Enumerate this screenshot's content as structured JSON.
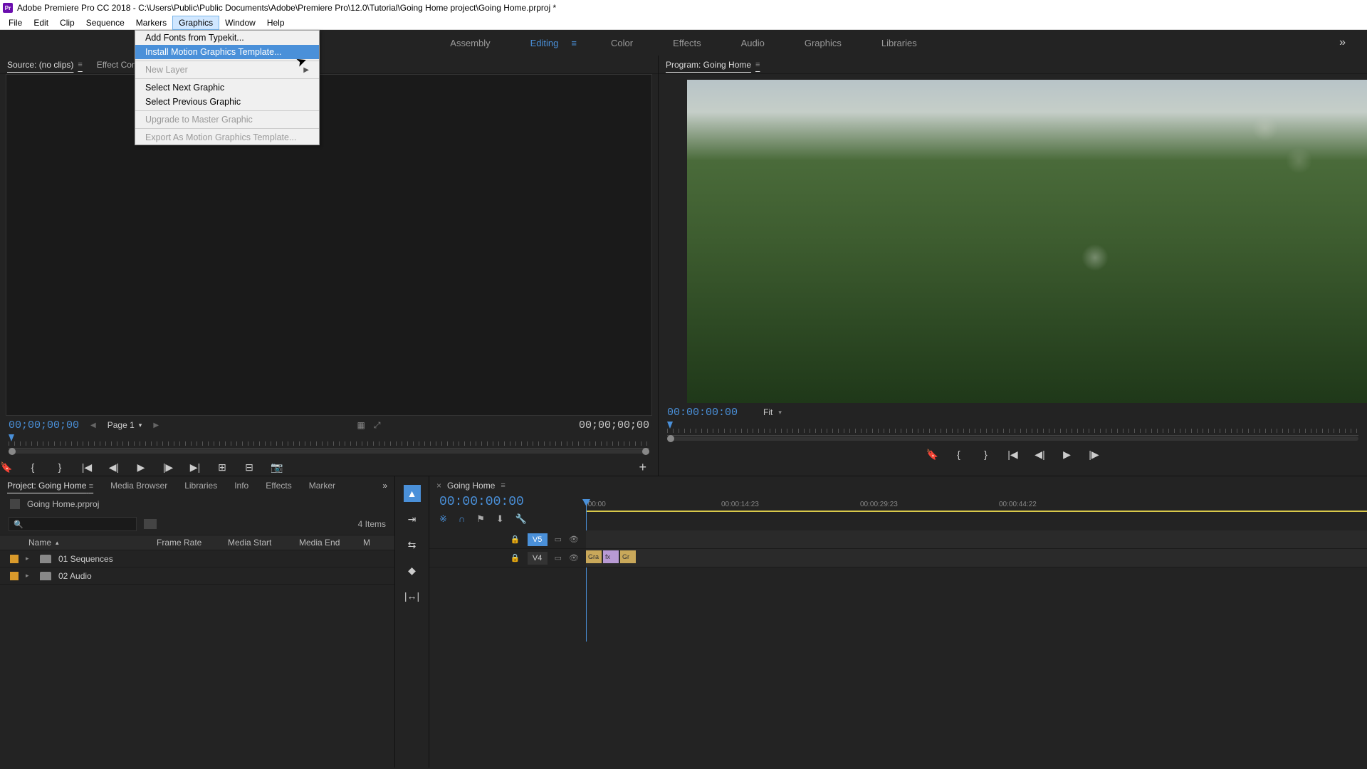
{
  "title": "Adobe Premiere Pro CC 2018 - C:\\Users\\Public\\Public Documents\\Adobe\\Premiere Pro\\12.0\\Tutorial\\Going Home project\\Going Home.prproj *",
  "app_icon": "Pr",
  "menubar": [
    "File",
    "Edit",
    "Clip",
    "Sequence",
    "Markers",
    "Graphics",
    "Window",
    "Help"
  ],
  "menubar_active": "Graphics",
  "workspaces": [
    "Assembly",
    "Editing",
    "Color",
    "Effects",
    "Audio",
    "Graphics",
    "Libraries"
  ],
  "workspace_active": "Editing",
  "dropdown": [
    {
      "label": "Add Fonts from Typekit...",
      "type": "item"
    },
    {
      "label": "Install Motion Graphics Template...",
      "type": "item",
      "highlighted": true
    },
    {
      "type": "sep"
    },
    {
      "label": "New Layer",
      "type": "item",
      "disabled": true,
      "submenu": true
    },
    {
      "type": "sep"
    },
    {
      "label": "Select Next Graphic",
      "type": "item"
    },
    {
      "label": "Select Previous Graphic",
      "type": "item"
    },
    {
      "type": "sep"
    },
    {
      "label": "Upgrade to Master Graphic",
      "type": "item",
      "disabled": true
    },
    {
      "type": "sep"
    },
    {
      "label": "Export As Motion Graphics Template...",
      "type": "item",
      "disabled": true
    }
  ],
  "source": {
    "tabs": [
      "Source: (no clips)",
      "Effect Cont"
    ],
    "timecode_left": "00;00;00;00",
    "page": "Page 1",
    "timecode_right": "00;00;00;00"
  },
  "program": {
    "title": "Program: Going Home",
    "timecode_left": "00:00:00:00",
    "fit": "Fit"
  },
  "project": {
    "tabs": [
      "Project: Going Home",
      "Media Browser",
      "Libraries",
      "Info",
      "Effects",
      "Marker"
    ],
    "filename": "Going Home.prproj",
    "item_count": "4 Items",
    "columns": {
      "name": "Name",
      "fr": "Frame Rate",
      "ms": "Media Start",
      "me": "Media End",
      "md": "M"
    },
    "rows": [
      {
        "label": "01 Sequences"
      },
      {
        "label": "02 Audio"
      }
    ]
  },
  "timeline": {
    "name": "Going Home",
    "timecode": "00:00:00:00",
    "ruler": [
      {
        "pos": 0,
        "label": ":00:00"
      },
      {
        "pos": 190,
        "label": "00:00:14:23"
      },
      {
        "pos": 385,
        "label": "00:00:29:23"
      },
      {
        "pos": 580,
        "label": "00:00:44:22"
      }
    ],
    "tracks": [
      {
        "name": "V5",
        "active": true
      },
      {
        "name": "V4",
        "active": false
      }
    ]
  }
}
